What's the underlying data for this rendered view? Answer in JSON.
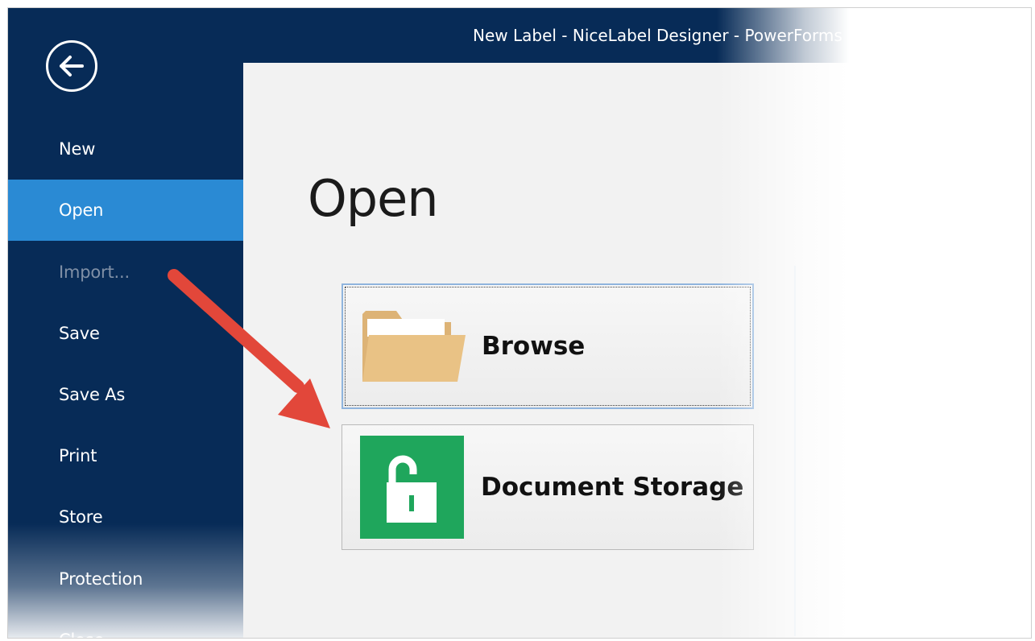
{
  "window": {
    "title": "New Label - NiceLabel Designer - PowerForms"
  },
  "sidebar": {
    "back_icon": "arrow-left-circle-icon",
    "items": [
      {
        "label": "New"
      },
      {
        "label": "Open"
      },
      {
        "label": "Import..."
      },
      {
        "label": "Save"
      },
      {
        "label": "Save As"
      },
      {
        "label": "Print"
      },
      {
        "label": "Store"
      },
      {
        "label": "Protection"
      },
      {
        "label": "Close"
      }
    ]
  },
  "main": {
    "title": "Open",
    "buttons": [
      {
        "label": "Browse",
        "icon": "folder-icon"
      },
      {
        "label": "Document Storage",
        "icon": "unlocked-padlock-icon"
      }
    ]
  },
  "annotation": {
    "icon": "red-pointer-arrow-icon"
  },
  "colors": {
    "sidebar_bg": "#072b57",
    "active_item_bg": "#2a8ad4",
    "storage_tile": "#1fa65c",
    "folder": "#e9c285",
    "annotation_arrow": "#e2473a"
  }
}
